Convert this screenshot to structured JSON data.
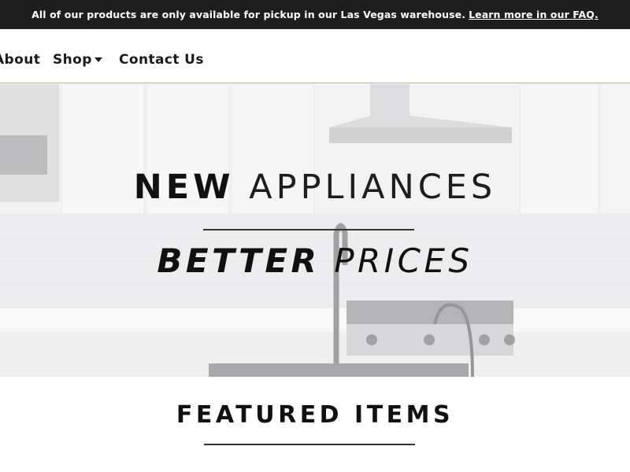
{
  "announcement": {
    "text": "All of our products are only available for pickup in our Las Vegas warehouse.",
    "link_text": "Learn more in our FAQ."
  },
  "nav": {
    "about": "About",
    "shop": "Shop",
    "contact": "Contact Us"
  },
  "hero": {
    "line1_bold": "NEW",
    "line1_light": "APPLIANCES",
    "line2_bold": "BETTER",
    "line2_light": "PRICES"
  },
  "featured": {
    "title": "FEATURED ITEMS"
  },
  "colors": {
    "topbar_bg": "#1e1e1e",
    "nav_divider": "#b9a98a",
    "text": "#111111"
  },
  "icons": {
    "shop_dropdown": "caret-down-icon"
  }
}
